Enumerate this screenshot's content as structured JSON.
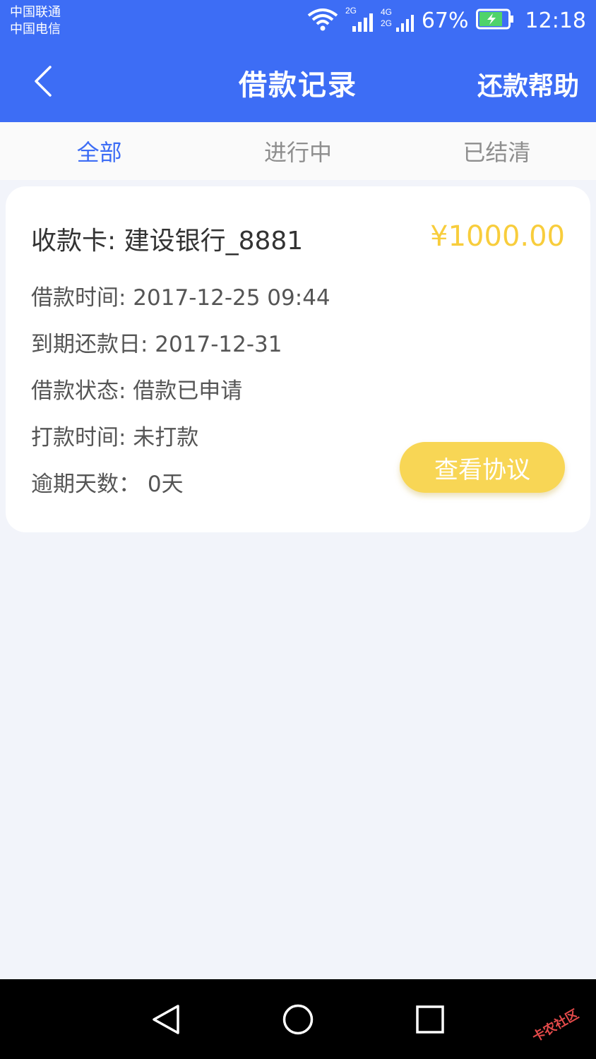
{
  "status_bar": {
    "carrier1": "中国联通",
    "carrier2": "中国电信",
    "net1": "2G",
    "net2a": "4G",
    "net2b": "2G",
    "battery": "67%",
    "time": "12:18"
  },
  "header": {
    "title": "借款记录",
    "help_label": "还款帮助"
  },
  "tabs": [
    {
      "label": "全部",
      "active": true
    },
    {
      "label": "进行中",
      "active": false
    },
    {
      "label": "已结清",
      "active": false
    }
  ],
  "record": {
    "receive_card": "收款卡: 建设银行_8881",
    "amount": "¥1000.00",
    "loan_time": "借款时间: 2017-12-25 09:44",
    "due_date": "到期还款日: 2017-12-31",
    "status": "借款状态: 借款已申请",
    "pay_time": "打款时间: 未打款",
    "overdue": "逾期天数： 0天",
    "view_button": "查看协议"
  },
  "colors": {
    "primary": "#3d6df5",
    "accent": "#f8cd3c",
    "button": "#f8d655",
    "background": "#f2f4fa"
  },
  "watermark": {
    "text": "卡农社区"
  },
  "nav_icons": [
    "back-triangle-icon",
    "home-circle-icon",
    "recents-square-icon"
  ]
}
